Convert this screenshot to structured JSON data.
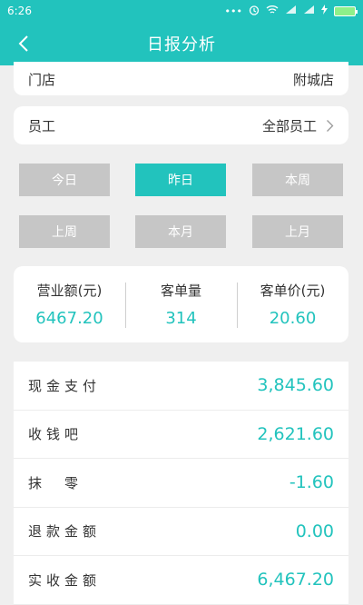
{
  "status_bar": {
    "time": "6:26",
    "icons": [
      "dots-icon",
      "alarm-icon",
      "wifi-icon",
      "signal-icon",
      "signal-icon",
      "charging-icon",
      "battery-icon"
    ]
  },
  "header": {
    "title": "日报分析",
    "back_icon": "chevron-left-icon"
  },
  "store": {
    "label": "门店",
    "value": "附城店"
  },
  "staff": {
    "label": "员工",
    "value": "全部员工"
  },
  "ranges": [
    {
      "label": "今日",
      "active": false
    },
    {
      "label": "昨日",
      "active": true
    },
    {
      "label": "本周",
      "active": false
    },
    {
      "label": "上周",
      "active": false
    },
    {
      "label": "本月",
      "active": false
    },
    {
      "label": "上月",
      "active": false
    }
  ],
  "summary": [
    {
      "label": "营业额(元)",
      "value": "6467.20"
    },
    {
      "label": "客单量",
      "value": "314"
    },
    {
      "label": "客单价(元)",
      "value": "20.60"
    }
  ],
  "details": [
    {
      "label": "现金支付",
      "amount": "3,845.60"
    },
    {
      "label": "收钱吧",
      "amount": "2,621.60"
    },
    {
      "label": "抹　零",
      "amount": "-1.60"
    },
    {
      "label": "退款金额",
      "amount": "0.00"
    },
    {
      "label": "实收金额",
      "amount": "6,467.20"
    }
  ],
  "colors": {
    "accent": "#22c3bd",
    "inactive_button": "#c6c6c6",
    "background": "#efefef"
  }
}
